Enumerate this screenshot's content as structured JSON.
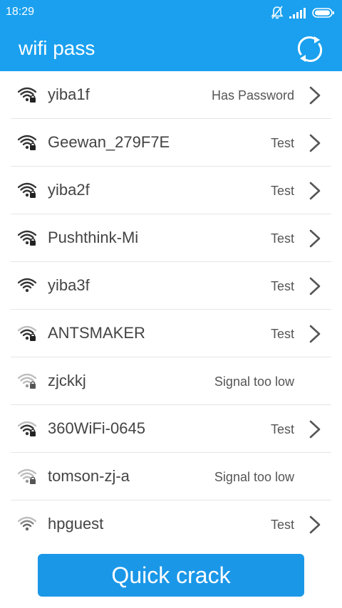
{
  "status_bar": {
    "time": "18:29",
    "icons": [
      "notifications-off-icon",
      "signal-bars-icon",
      "battery-icon"
    ]
  },
  "app_bar": {
    "title": "wifi pass",
    "refresh_icon": "refresh-icon"
  },
  "colors": {
    "primary": "#1aa0ef",
    "button": "#1b97e8",
    "text": "#444444",
    "divider": "#e6e6e6"
  },
  "networks": [
    {
      "ssid": "yiba1f",
      "status": "Has Password",
      "signal": "strong",
      "locked": true,
      "chevron": true
    },
    {
      "ssid": "Geewan_279F7E",
      "status": "Test",
      "signal": "strong",
      "locked": true,
      "chevron": true
    },
    {
      "ssid": "yiba2f",
      "status": "Test",
      "signal": "strong",
      "locked": true,
      "chevron": true
    },
    {
      "ssid": "Pushthink-Mi",
      "status": "Test",
      "signal": "strong",
      "locked": true,
      "chevron": true
    },
    {
      "ssid": "yiba3f",
      "status": "Test",
      "signal": "strong",
      "locked": false,
      "chevron": true
    },
    {
      "ssid": "ANTSMAKER",
      "status": "Test",
      "signal": "medium",
      "locked": true,
      "chevron": true
    },
    {
      "ssid": "zjckkj",
      "status": "Signal too low",
      "signal": "weak",
      "locked": true,
      "chevron": false
    },
    {
      "ssid": "360WiFi-0645",
      "status": "Test",
      "signal": "medium",
      "locked": true,
      "chevron": true
    },
    {
      "ssid": "tomson-zj-a",
      "status": "Signal too low",
      "signal": "weak",
      "locked": true,
      "chevron": false
    },
    {
      "ssid": "hpguest",
      "status": "Test",
      "signal": "medium-light",
      "locked": false,
      "chevron": true
    }
  ],
  "actions": {
    "quick_crack_label": "Quick crack"
  }
}
